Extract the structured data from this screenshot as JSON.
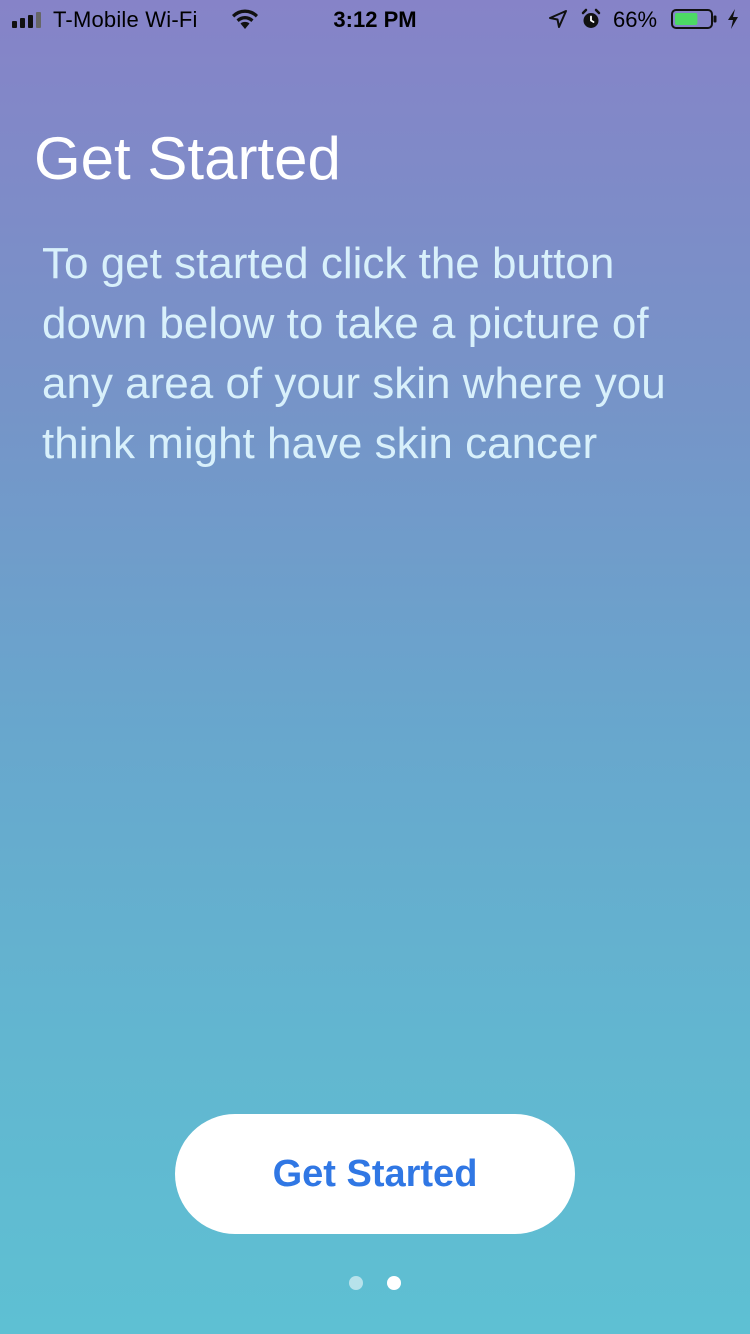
{
  "status_bar": {
    "carrier": "T-Mobile Wi-Fi",
    "time": "3:12 PM",
    "battery_percent": "66%",
    "battery_level": 0.66,
    "signal_bars": 4,
    "icons": [
      "signal-icon",
      "wifi-icon",
      "location-arrow-icon",
      "alarm-icon",
      "battery-icon",
      "charging-bolt-icon"
    ]
  },
  "main": {
    "title": "Get Started",
    "description": "To get started click the button down below to take a picture of any area of your skin where you think might have skin cancer",
    "button_label": "Get Started"
  },
  "pagination": {
    "total": 2,
    "active_index": 1
  },
  "colors": {
    "gradient_top": "#8683c8",
    "gradient_bottom": "#5ec0d3",
    "button_text": "#3077e4",
    "title_text": "#ffffff",
    "description_text": "#d8f0fb"
  }
}
